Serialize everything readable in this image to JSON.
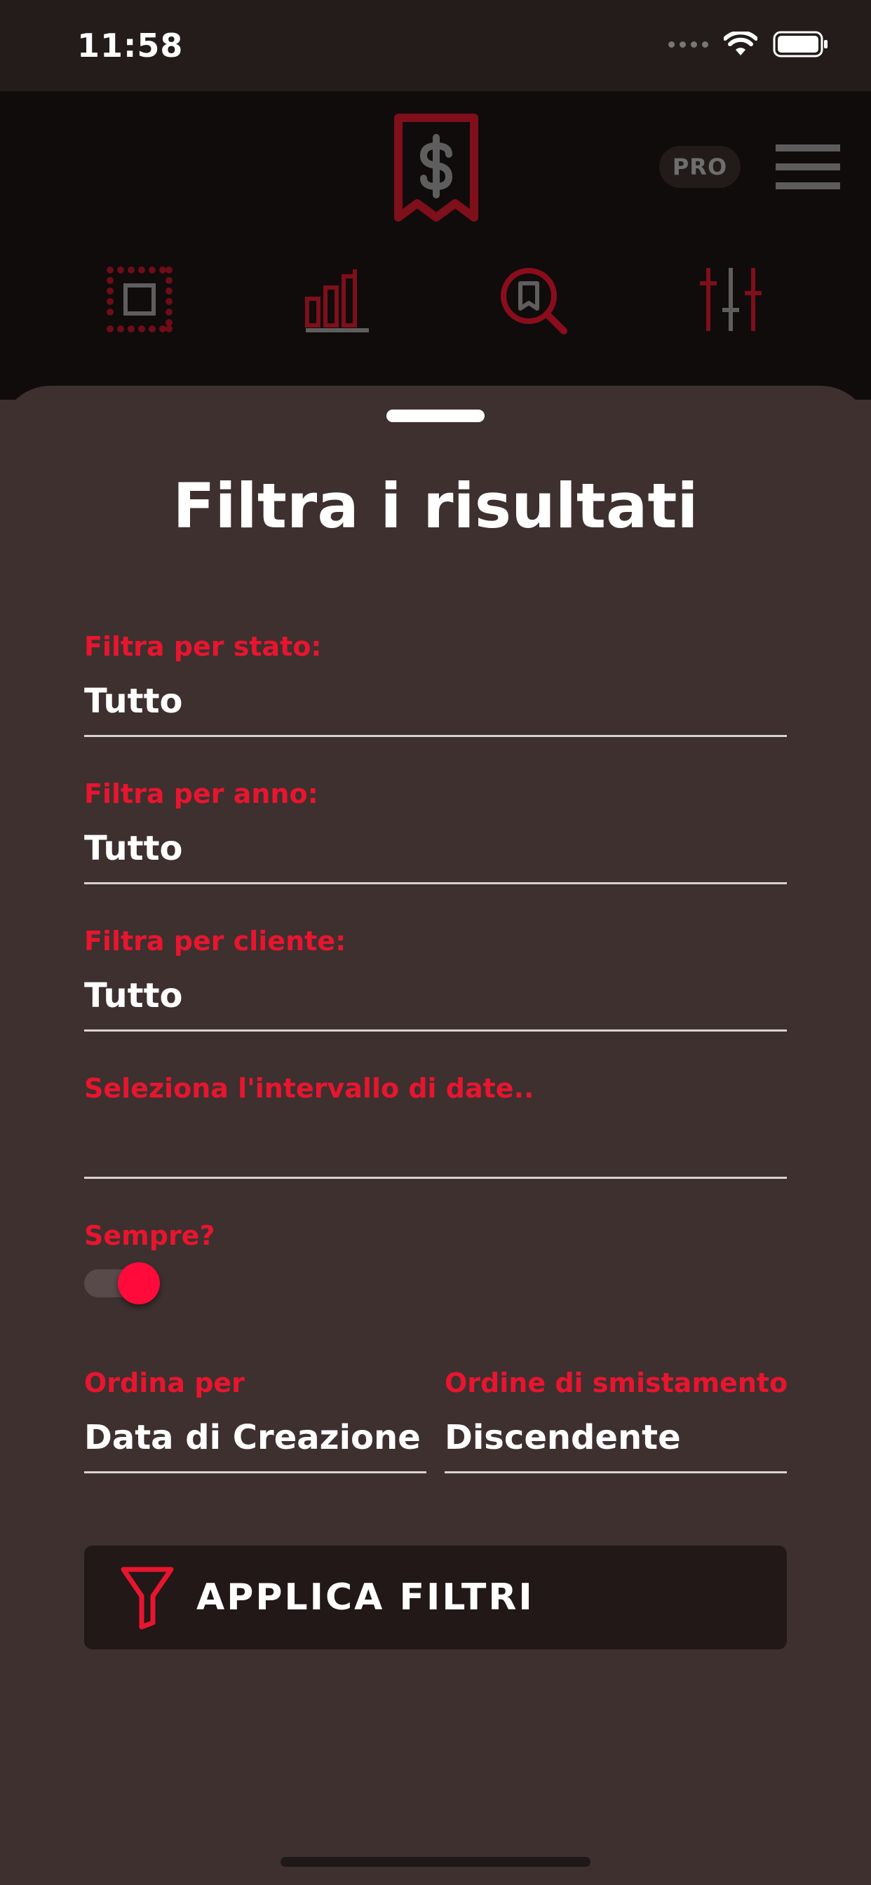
{
  "status_bar": {
    "time": "11:58",
    "icons": [
      "signal-icon",
      "wifi-icon",
      "battery-icon"
    ]
  },
  "header": {
    "logo_icon": "receipt-dollar-icon",
    "pro_badge": "PRO",
    "menu_icon": "hamburger-menu-icon",
    "tabs": [
      {
        "icon": "select-square-icon",
        "active": false
      },
      {
        "icon": "bar-chart-icon",
        "active": false
      },
      {
        "icon": "search-receipt-icon",
        "active": true
      },
      {
        "icon": "sliders-icon",
        "active": false
      }
    ]
  },
  "sheet": {
    "title": "Filtra i risultati",
    "fields": {
      "status": {
        "label": "Filtra per stato:",
        "value": "Tutto"
      },
      "year": {
        "label": "Filtra per anno:",
        "value": "Tutto"
      },
      "client": {
        "label": "Filtra per cliente:",
        "value": "Tutto"
      },
      "date_range": {
        "label": "Seleziona l'intervallo di date..",
        "value": ""
      }
    },
    "always": {
      "label": "Sempre?",
      "on": true
    },
    "sort_by": {
      "label": "Ordina per",
      "value": "Data di Creazione"
    },
    "sort_order": {
      "label": "Ordine di smistamento",
      "value": "Discendente"
    },
    "apply_button": {
      "label": "APPLICA FILTRI",
      "icon": "funnel-icon"
    }
  },
  "colors": {
    "accent": "#e8152f",
    "toggle_on": "#ff0a3a",
    "sheet_background": "#3d302f",
    "header_background": "#0f0c0b",
    "button_background": "#211817"
  }
}
